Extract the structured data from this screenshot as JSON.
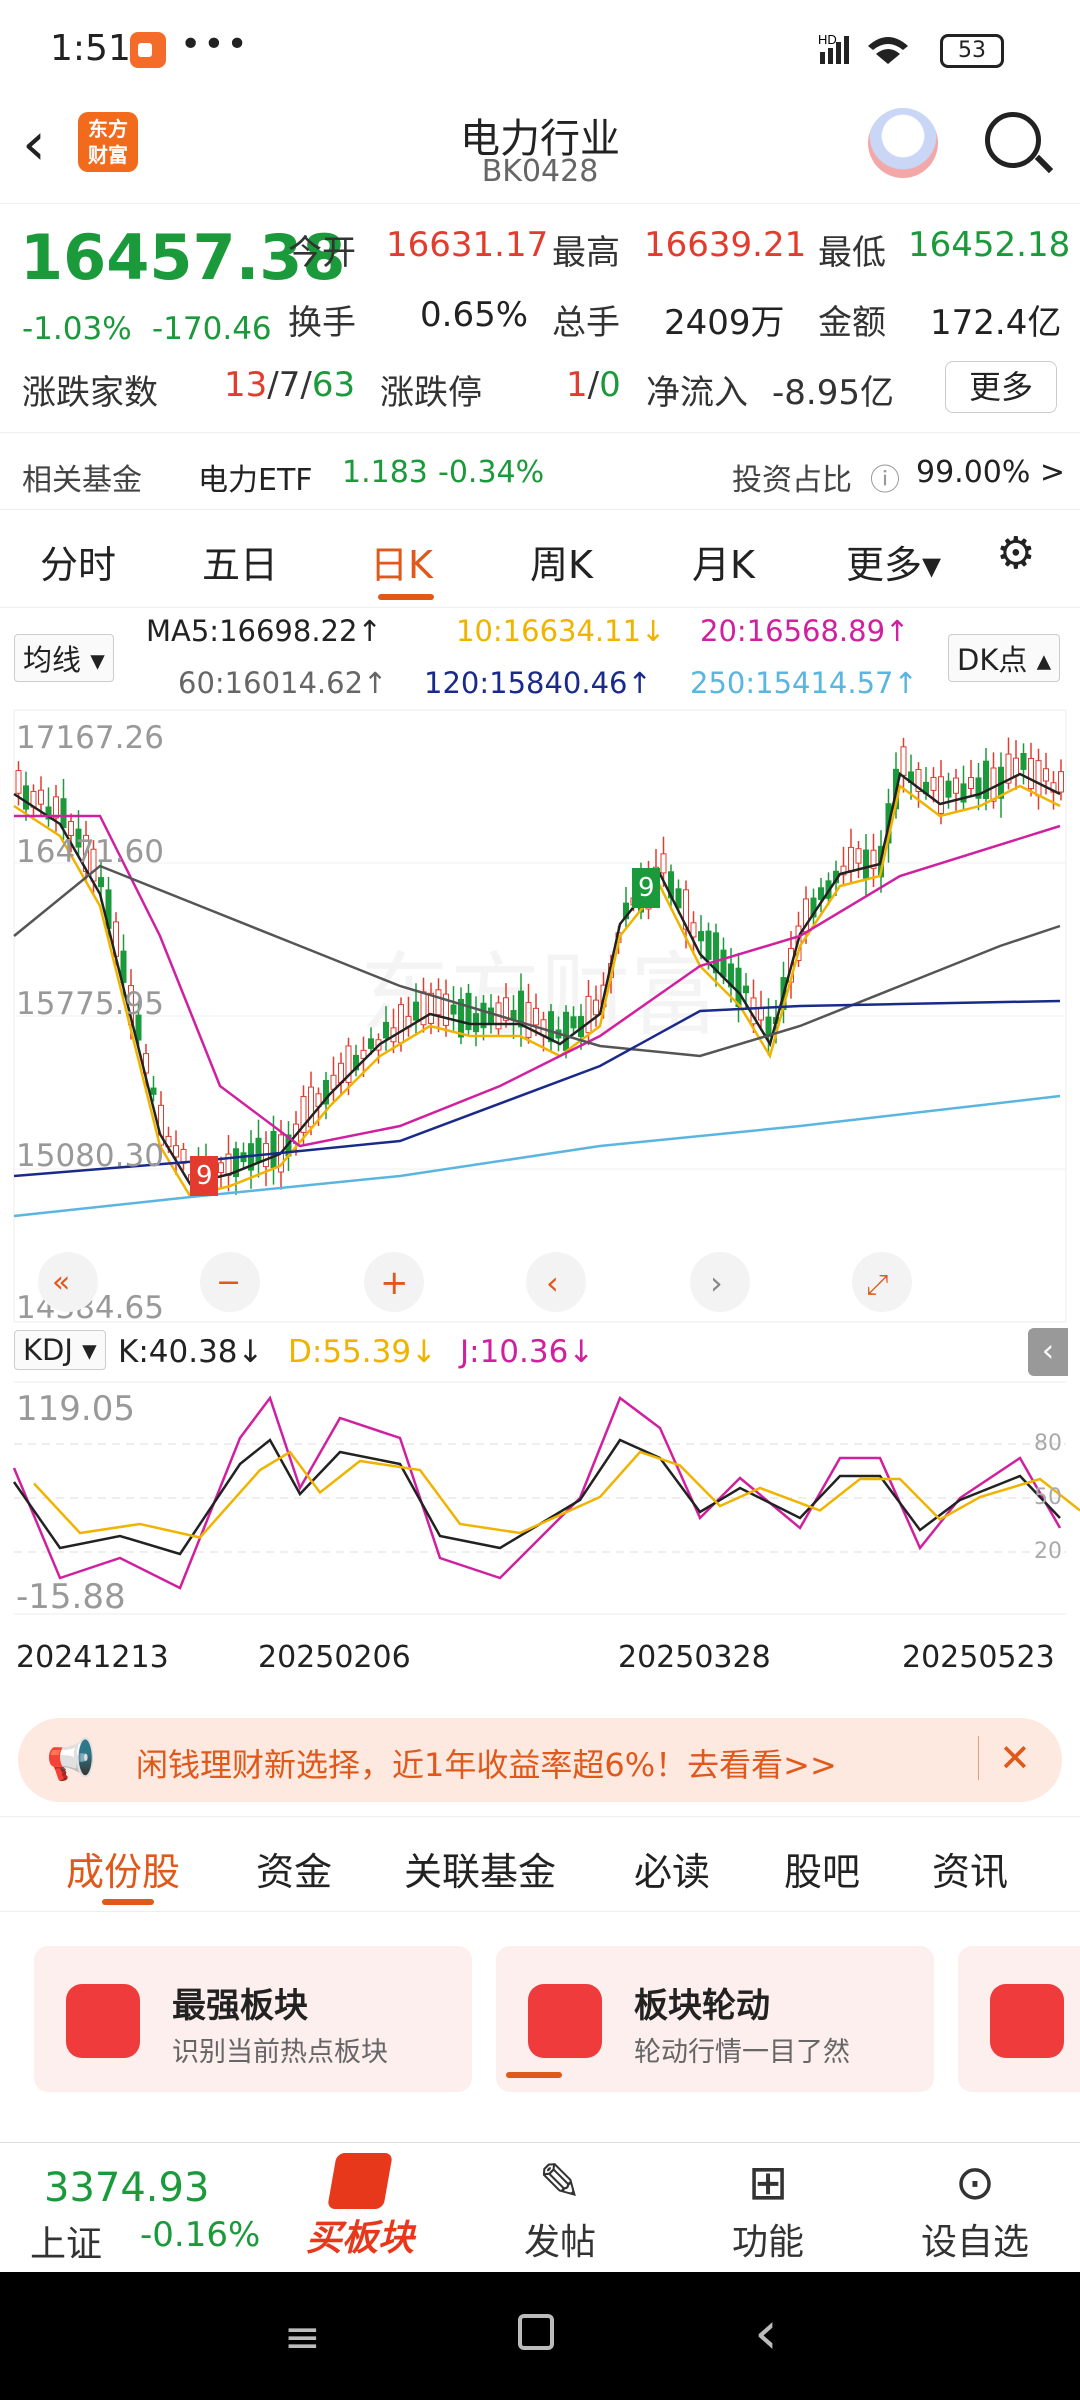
{
  "status": {
    "time": "1:51",
    "dots": "•••",
    "battery": "53",
    "signal": "HD"
  },
  "nav": {
    "title": "电力行业",
    "code": "BK0428",
    "logo": "东方财富"
  },
  "quote": {
    "price": "16457.38",
    "pct": "-1.03%",
    "chg": "-170.46",
    "open_label": "今开",
    "open": "16631.17",
    "high_label": "最高",
    "high": "16639.21",
    "low_label": "最低",
    "low": "16452.18",
    "turn_label": "换手",
    "turn": "0.65%",
    "vol_label": "总手",
    "vol": "2409万",
    "amt_label": "金额",
    "amt": "172.4亿",
    "adv_label": "涨跌家数",
    "adv_up": "13",
    "adv_flat": "7",
    "adv_down": "63",
    "lim_label": "涨跌停",
    "lim_up": "1",
    "lim_down": "0",
    "flow_label": "净流入",
    "flow": "-8.95亿",
    "more": "更多"
  },
  "fund": {
    "label": "相关基金",
    "name": "电力ETF",
    "price": "1.183",
    "pct": "-0.34%",
    "ratio_label": "投资占比",
    "ratio": "99.00% >"
  },
  "tabs": [
    "分时",
    "五日",
    "日K",
    "周K",
    "月K",
    "更多▾"
  ],
  "ma": {
    "selector": "均线",
    "ma5": "MA5:16698.22↑",
    "ma10": "10:16634.11↓",
    "ma20": "20:16568.89↑",
    "ma60": "60:16014.62↑",
    "ma120": "120:15840.46↑",
    "ma250": "250:15414.57↑",
    "dk": "DK点"
  },
  "chart_data": {
    "type": "candlestick",
    "y_labels": [
      "17167.26",
      "16471.60",
      "15775.95",
      "15080.30",
      "14384.65"
    ],
    "ylim": [
      14384.65,
      17167.26
    ],
    "signal_labels": [
      "9",
      "9"
    ]
  },
  "kdj": {
    "selector": "KDJ",
    "k": "K:40.38↓",
    "d": "D:55.39↓",
    "j": "J:10.36↓",
    "top": "119.05",
    "bottom": "-15.88",
    "l80": "80",
    "l50": "50",
    "l20": "20"
  },
  "dates": [
    "20241213",
    "20250206",
    "20250328",
    "20250523"
  ],
  "banner": {
    "text": "闲钱理财新选择，近1年收益率超6%！去看看>>",
    "close": "✕"
  },
  "btabs": [
    "成份股",
    "资金",
    "关联基金",
    "必读",
    "股吧",
    "资讯"
  ],
  "cards": [
    {
      "title": "最强板块",
      "desc": "识别当前热点板块"
    },
    {
      "title": "板块轮动",
      "desc": "轮动行情一目了然"
    }
  ],
  "bottom": {
    "index_val": "3374.93",
    "index_name": "上证",
    "index_pct": "-0.16%",
    "buy": "买板块",
    "post": "发帖",
    "func": "功能",
    "watch": "设自选"
  },
  "colors": {
    "up": "#e33b2e",
    "down": "#1a9a3a",
    "accent": "#e0581a"
  }
}
